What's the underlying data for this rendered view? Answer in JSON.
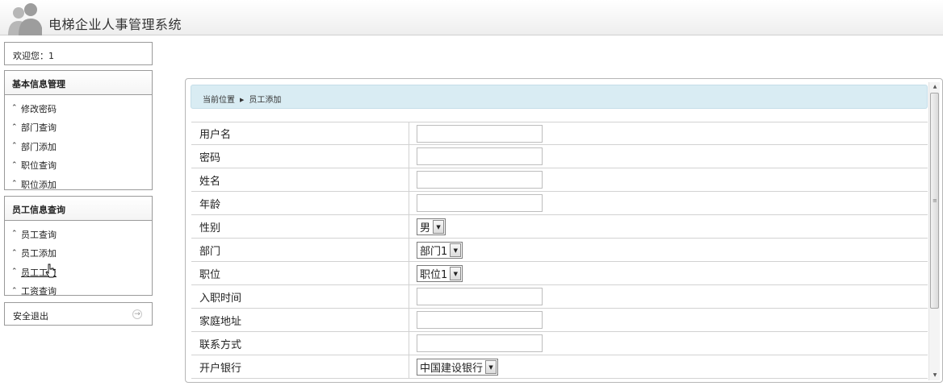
{
  "app": {
    "title": "电梯企业人事管理系统"
  },
  "sidebar": {
    "welcome": "欢迎您：1",
    "groups": [
      {
        "title": "基本信息管理",
        "items": [
          {
            "label": "修改密码"
          },
          {
            "label": "部门查询"
          },
          {
            "label": "部门添加"
          },
          {
            "label": "职位查询"
          },
          {
            "label": "职位添加"
          }
        ]
      },
      {
        "title": "员工信息查询",
        "items": [
          {
            "label": "员工查询"
          },
          {
            "label": "员工添加"
          },
          {
            "label": "员工工资"
          },
          {
            "label": "工资查询"
          }
        ]
      }
    ],
    "logout": "安全退出"
  },
  "breadcrumb": {
    "prefix": "当前位置",
    "current": "员工添加"
  },
  "form": {
    "fields": [
      {
        "label": "用户名",
        "value": ""
      },
      {
        "label": "密码",
        "value": ""
      },
      {
        "label": "姓名",
        "value": ""
      },
      {
        "label": "年龄",
        "value": ""
      },
      {
        "label": "性别",
        "value": "男"
      },
      {
        "label": "部门",
        "value": "部门1"
      },
      {
        "label": "职位",
        "value": "职位1"
      },
      {
        "label": "入职时间",
        "value": ""
      },
      {
        "label": "家庭地址",
        "value": ""
      },
      {
        "label": "联系方式",
        "value": ""
      },
      {
        "label": "开户银行",
        "value": "中国建设银行"
      }
    ]
  },
  "icons": {
    "menu_bullet": "double-chevron-up-icon",
    "logout": "arrow-right-circle-icon",
    "select_arrow": "triangle-down-icon"
  },
  "colors": {
    "breadcrumb_bg": "#d9ecf3",
    "border": "#9a9a9a"
  }
}
